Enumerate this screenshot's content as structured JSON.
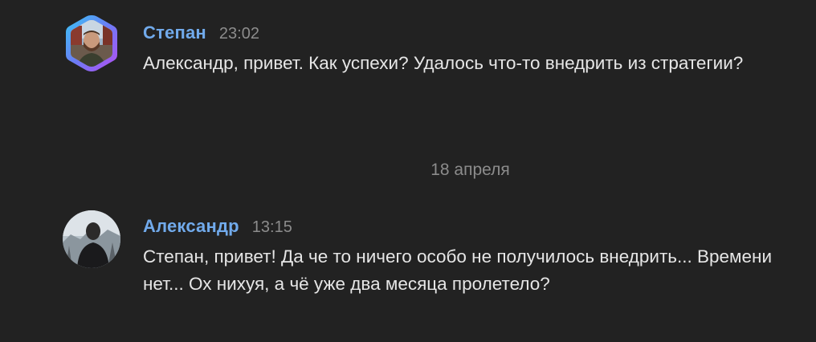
{
  "messages": [
    {
      "author": "Степан",
      "time": "23:02",
      "text": "Александр, привет. Как успехи? Удалось что-то внедрить из стратегии?"
    },
    {
      "author": "Александр",
      "time": "13:15",
      "text": "Степан, привет! Да че то ничего особо не получилось внедрить... Времени нет... Ох нихуя, а чё уже два месяца пролетело?"
    }
  ],
  "date_separator": "18 апреля",
  "colors": {
    "background": "#222222",
    "author_name": "#71aaeb",
    "message_text": "#e6e6e6",
    "muted_text": "#8c8c8c"
  }
}
